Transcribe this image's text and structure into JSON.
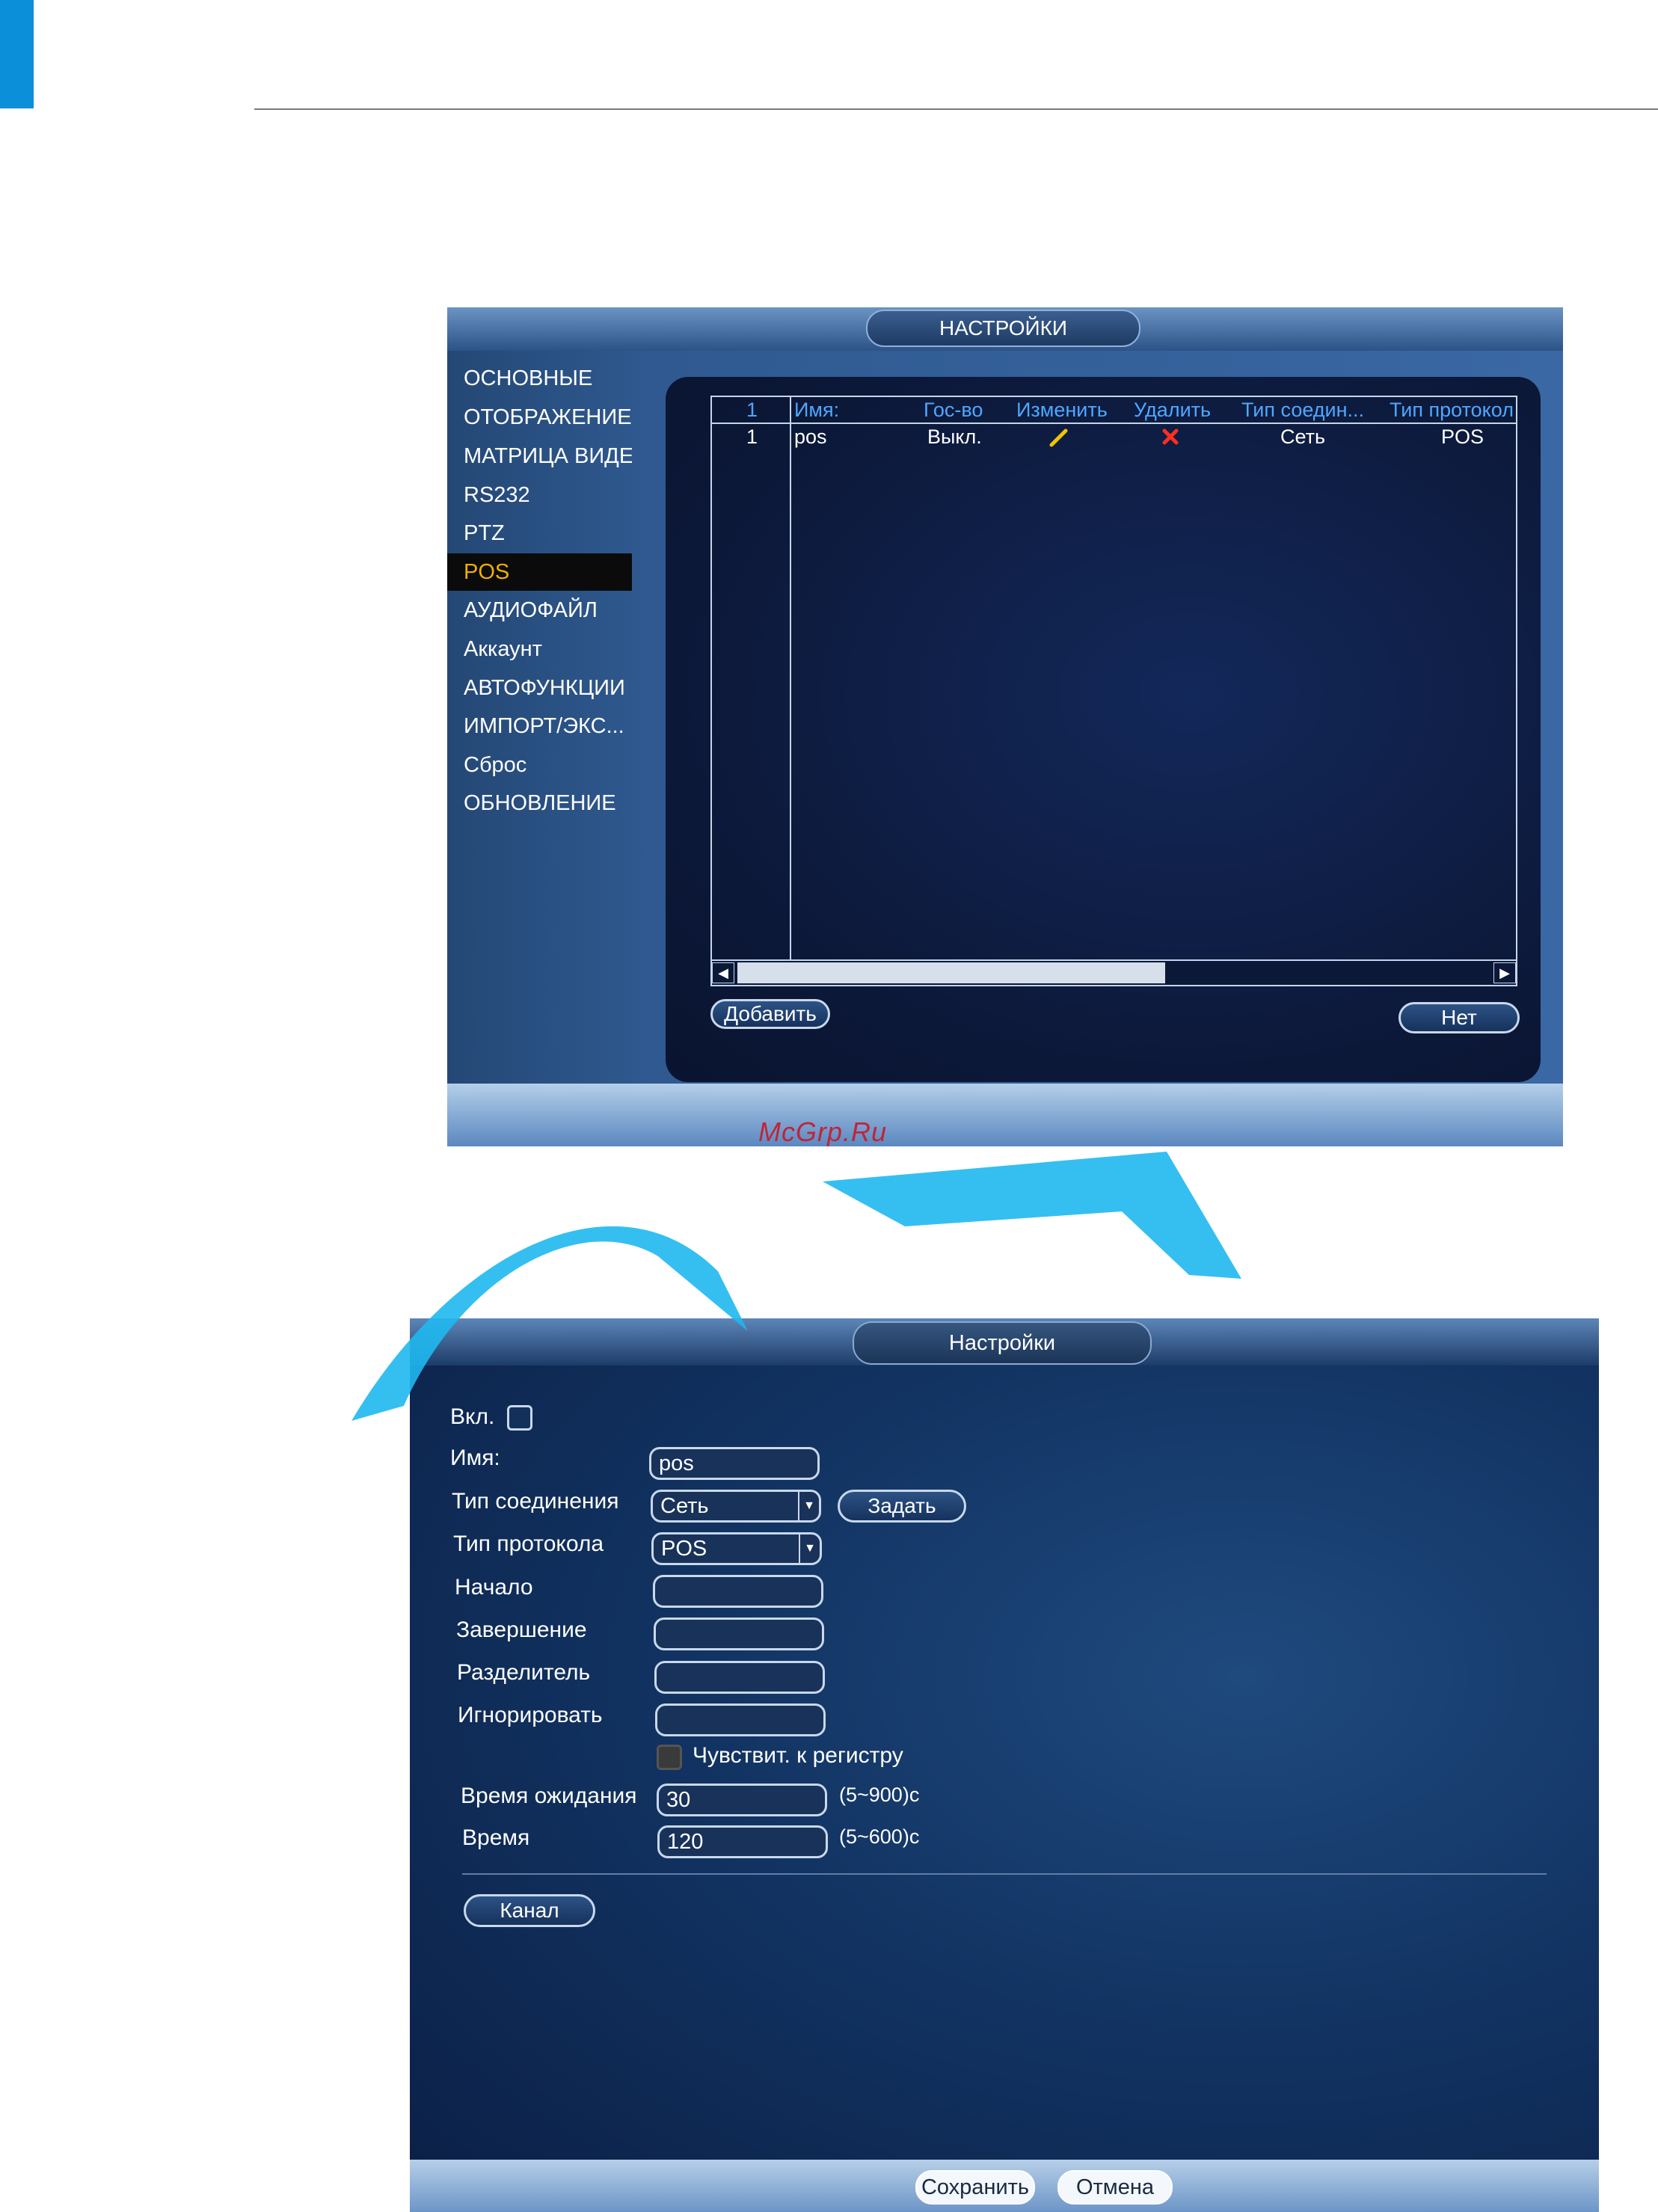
{
  "screen1": {
    "title": "НАСТРОЙКИ",
    "menu": [
      {
        "label": "ОСНОВНЫЕ",
        "active": false
      },
      {
        "label": "ОТОБРАЖЕНИЕ",
        "active": false
      },
      {
        "label": "МАТРИЦА ВИДЕ",
        "active": false
      },
      {
        "label": "RS232",
        "active": false
      },
      {
        "label": "PTZ",
        "active": false
      },
      {
        "label": "POS",
        "active": true
      },
      {
        "label": "АУДИОФАЙЛ",
        "active": false
      },
      {
        "label": "Аккаунт",
        "active": false
      },
      {
        "label": "АВТОФУНКЦИИ",
        "active": false
      },
      {
        "label": "ИМПОРТ/ЭКС...",
        "active": false
      },
      {
        "label": "Сброс",
        "active": false
      },
      {
        "label": "ОБНОВЛЕНИЕ",
        "active": false
      }
    ],
    "table": {
      "headers": [
        "1",
        "Имя:",
        "Гос-во",
        "Изменить",
        "Удалить",
        "Тип соедин...",
        "Тип протокол"
      ],
      "rows": [
        {
          "num": "1",
          "name": "pos",
          "state": "Выкл.",
          "connection": "Сеть",
          "protocol": "POS"
        }
      ]
    },
    "add_button": "Добавить",
    "no_button": "Нет",
    "watermark": "McGrp.Ru"
  },
  "screen2": {
    "title": "Настройки",
    "enable_label": "Вкл.",
    "name_label": "Имя:",
    "name_value": "pos",
    "connection_label": "Тип соединения",
    "connection_value": "Сеть",
    "set_button": "Задать",
    "protocol_label": "Тип протокола",
    "protocol_value": "POS",
    "start_label": "Начало",
    "end_label": "Завершение",
    "separator_label": "Разделитель",
    "ignore_label": "Игнорировать",
    "case_label": "Чувствит. к регистру",
    "timeout_label": "Время ожидания",
    "timeout_value": "30",
    "timeout_hint": "(5~900)с",
    "time_label": "Время",
    "time_value": "120",
    "time_hint": "(5~600)с",
    "channel_button": "Канал",
    "save_button": "Сохранить",
    "cancel_button": "Отмена"
  }
}
